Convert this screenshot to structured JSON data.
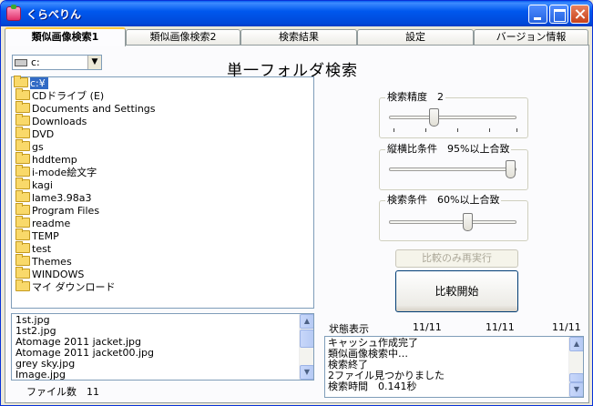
{
  "window": {
    "title": "くらべりん"
  },
  "tabs": [
    {
      "label": "類似画像検索1",
      "active": true
    },
    {
      "label": "類似画像検索2",
      "active": false
    },
    {
      "label": "検索結果",
      "active": false
    },
    {
      "label": "設定",
      "active": false
    },
    {
      "label": "バージョン情報",
      "active": false
    }
  ],
  "drive": {
    "value": "c:"
  },
  "heading": "単一フォルダ検索",
  "tree": {
    "root": "c:¥",
    "items": [
      "CDドライブ (E)",
      "Documents and Settings",
      "Downloads",
      "DVD",
      "gs",
      "hddtemp",
      "i-mode絵文字",
      "kagi",
      "lame3.98a3",
      "Program Files",
      "readme",
      "TEMP",
      "test",
      "Themes",
      "WINDOWS",
      "マイ ダウンロード"
    ]
  },
  "files": {
    "items": [
      "1st.jpg",
      "1st2.jpg",
      "Atomage 2011 jacket.jpg",
      "Atomage 2011 jacket00.jpg",
      "grey sky.jpg",
      "Image.jpg"
    ],
    "count_label": "ファイル数",
    "count": "11"
  },
  "settings": {
    "precision": {
      "label": "検索精度",
      "value": "2",
      "fraction": 0.35
    },
    "aspect": {
      "label": "縦横比条件",
      "value": "95%以上合致",
      "fraction": 0.95
    },
    "match": {
      "label": "検索条件",
      "value": "60%以上合致",
      "fraction": 0.62
    }
  },
  "buttons": {
    "rerun": "比較のみ再実行",
    "start": "比較開始"
  },
  "status": {
    "label": "状態表示",
    "counts": [
      "11/11",
      "11/11",
      "11/11"
    ],
    "log": [
      "キャッシュ作成完了",
      "類似画像検索中…",
      "検索終了",
      "2ファイル見つかりました",
      "検索時間　0.141秒"
    ]
  }
}
